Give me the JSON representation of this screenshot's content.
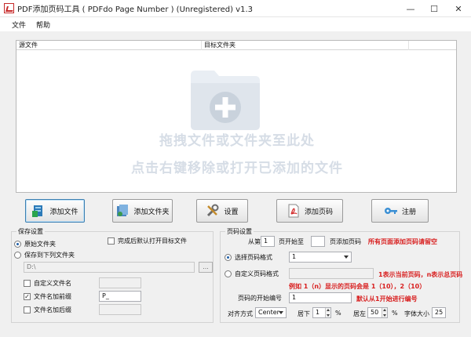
{
  "window": {
    "title": "PDF添加页码工具 ( PDFdo Page Number ) (Unregistered) v1.3",
    "minimize": "—",
    "maximize": "☐",
    "close": "✕"
  },
  "menu": [
    "文件",
    "帮助"
  ],
  "file_list": {
    "columns": [
      "源文件",
      "目标文件夹"
    ],
    "hint_line1": "拖拽文件或文件夹至此处",
    "hint_line2": "点击右键移除或打开已添加的文件"
  },
  "toolbar": {
    "add_file": "添加文件",
    "add_folder": "添加文件夹",
    "settings": "设置",
    "add_page_number": "添加页码",
    "register": "注册"
  },
  "save_settings": {
    "title": "保存设置",
    "original_folder": "原始文件夹",
    "save_to_folder": "保存到下列文件夹",
    "open_after": "完成后默认打开目标文件",
    "path_value": "D:\\",
    "browse": "...",
    "custom_filename": "自定义文件名",
    "add_prefix": "文件名加前缀",
    "prefix_value": "P_",
    "add_suffix": "文件名加后缀"
  },
  "page_settings": {
    "title": "页码设置",
    "from_label": "从第",
    "from_value": "1",
    "page_to_label": "页开始至",
    "to_value": "",
    "add_label": "页添加页码",
    "all_pages_note": "所有页面添加页码请留空",
    "choose_format": "选择页码格式",
    "format_value": "1",
    "custom_format": "自定义页码格式",
    "custom_note_1": "1表示当前页码，n表示总页码",
    "custom_note_2": "例如 1（n）显示的页码会是 1（10），2（10）",
    "start_number_label": "页码的开始编号",
    "start_number_value": "1",
    "start_number_note": "默认从1开始进行编号",
    "align_label": "对齐方式",
    "align_value": "Center",
    "bottom_label": "居下",
    "bottom_value": "1",
    "left_label": "居左",
    "left_value": "50",
    "percent": "%",
    "font_size_label": "字体大小",
    "font_size_value": "25"
  }
}
